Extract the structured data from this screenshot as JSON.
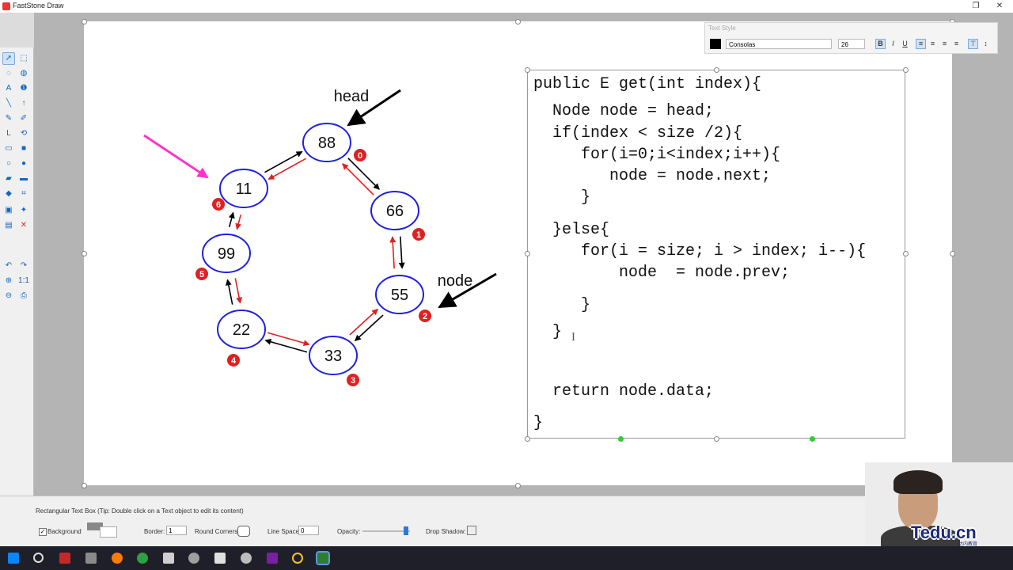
{
  "window": {
    "title": "FastStone Draw",
    "restore_glyph": "❐",
    "close_glyph": "✕"
  },
  "toolbox": {
    "tools": [
      "pointer-icon",
      "marquee-select-icon",
      "lasso-icon",
      "freeform-select-icon",
      "text-icon",
      "info-icon",
      "line-icon",
      "arrow-up-icon",
      "pen-icon",
      "eraser-icon",
      "connector-icon",
      "curve-icon",
      "rectangle-icon",
      "filled-rectangle-icon",
      "ellipse-icon",
      "filled-ellipse-icon",
      "highlighter-icon",
      "marker-icon",
      "fill-icon",
      "crop-icon",
      "image-icon",
      "magic-icon",
      "layers-icon",
      "delete-icon",
      "undo-icon",
      "redo-icon",
      "zoom-in-icon",
      "actual-size-icon",
      "zoom-out-icon",
      "print-icon"
    ]
  },
  "diagram": {
    "nodes": [
      {
        "value": "88",
        "index": "0"
      },
      {
        "value": "66",
        "index": "1"
      },
      {
        "value": "55",
        "index": "2"
      },
      {
        "value": "33",
        "index": "3"
      },
      {
        "value": "22",
        "index": "4"
      },
      {
        "value": "99",
        "index": "5"
      },
      {
        "value": "11",
        "index": "6"
      }
    ],
    "pointers": [
      {
        "label": "head"
      },
      {
        "label": "node"
      }
    ],
    "colors": {
      "node_border": "#1f1fe0",
      "badge": "#e02020",
      "next_arrow": "#000000",
      "prev_arrow": "#e02020",
      "highlight_arrow": "#ff33cc"
    }
  },
  "code": {
    "lines": [
      "public E get(int index){",
      "  Node node = head;",
      "  if(index < size /2){",
      "     for(i=0;i<index;i++){",
      "        node = node.next;",
      "     }",
      "  }else{",
      "     for(i = size; i > index; i--){",
      "         node  = node.prev;",
      "     }",
      "  }",
      "  return node.data;",
      "}"
    ],
    "cursor_glyph": "I"
  },
  "text_style": {
    "title": "Text Style",
    "font": "Consolas",
    "size": "26",
    "bold": "B",
    "italic": "I",
    "underline": "U"
  },
  "status": {
    "hint": "Rectangular Text Box  (Tip: Double click on a Text object to edit its content)",
    "background_label": "Background",
    "border_label": "Border:",
    "border_value": "1",
    "round_corners_label": "Round Corners:",
    "line_space_label": "Line Space:",
    "line_space_value": "0",
    "opacity_label": "Opacity:",
    "drop_shadow_label": "Drop Shadow:"
  },
  "webcam": {
    "logo": "Tedu.cn",
    "sub": "达内教育"
  }
}
